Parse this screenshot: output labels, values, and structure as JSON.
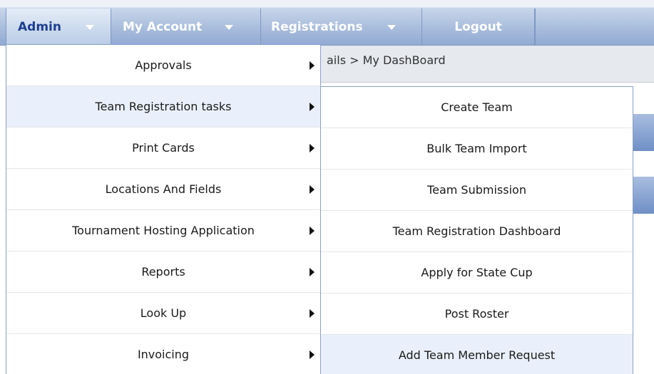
{
  "nav": {
    "admin": "Admin",
    "my_account": "My Account",
    "registrations": "Registrations",
    "logout": "Logout"
  },
  "breadcrumb": "ails > My DashBoard",
  "admin_menu": [
    {
      "label": "Approvals"
    },
    {
      "label": "Team Registration tasks"
    },
    {
      "label": "Print Cards"
    },
    {
      "label": "Locations And Fields"
    },
    {
      "label": "Tournament Hosting Application"
    },
    {
      "label": "Reports"
    },
    {
      "label": "Look Up"
    },
    {
      "label": "Invoicing"
    }
  ],
  "team_registration_submenu": [
    {
      "label": "Create Team"
    },
    {
      "label": "Bulk Team Import"
    },
    {
      "label": "Team Submission"
    },
    {
      "label": "Team Registration Dashboard"
    },
    {
      "label": "Apply for State Cup"
    },
    {
      "label": "Post Roster"
    },
    {
      "label": "Add Team Member Request"
    }
  ],
  "colors": {
    "nav_gradient_top": "#cfdcee",
    "nav_gradient_bottom": "#93abd3",
    "admin_text": "#1c3f8f",
    "nav_text": "#ffffff",
    "menu_highlight": "#eaf0fb",
    "menu_border": "#8aa0c8"
  },
  "icons": {
    "dropdown": "caret-down-icon",
    "submenu": "caret-right-icon"
  }
}
